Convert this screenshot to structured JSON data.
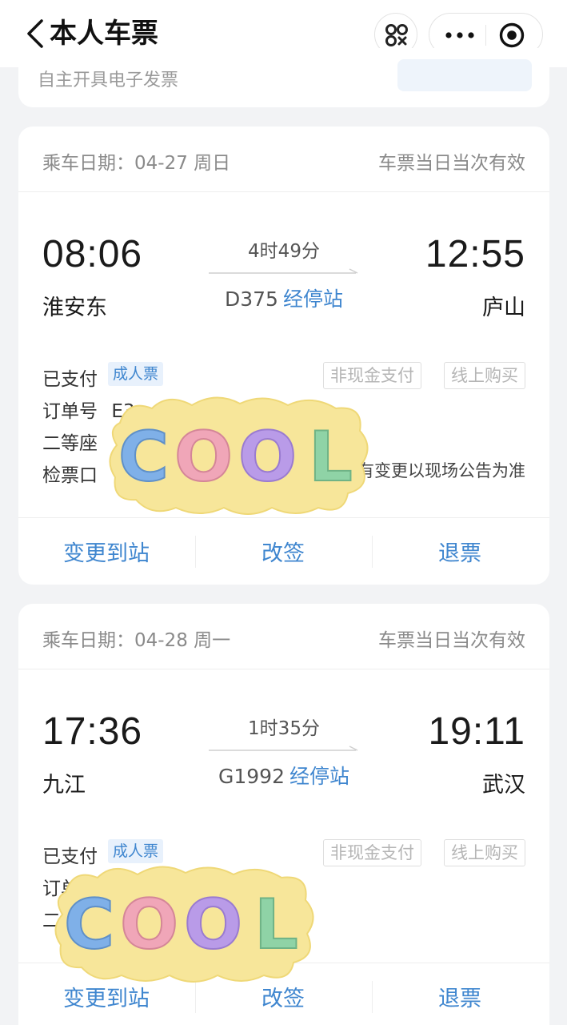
{
  "header": {
    "back_icon": "chevron-left-icon",
    "title": "本人车票",
    "scan_icon": "scan-icon",
    "more_icon": "more-dots-icon",
    "close_icon": "target-circle-icon"
  },
  "top_card": {
    "text": "自主开具电子发票"
  },
  "tickets": [
    {
      "date": "乘车日期：04-27 周日",
      "validity": "车票当日当次有效",
      "dep_time": "08:06",
      "dep_station": "淮安东",
      "duration": "4时49分",
      "train_no": "D375",
      "stops_link": "经停站",
      "arr_time": "12:55",
      "arr_station": "庐山",
      "paid": "已支付",
      "ticket_type": "成人票",
      "tag_cash": "非现金支付",
      "tag_online": "线上购买",
      "order_label": "订单号",
      "order_value": "E3",
      "seat_label": "二等座",
      "gate_label": "检票口",
      "gate_note": "有变更以现场公告为准",
      "actions": {
        "change_station": "变更到站",
        "reschedule": "改签",
        "refund": "退票"
      }
    },
    {
      "date": "乘车日期：04-28 周一",
      "validity": "车票当日当次有效",
      "dep_time": "17:36",
      "dep_station": "九江",
      "duration": "1时35分",
      "train_no": "G1992",
      "stops_link": "经停站",
      "arr_time": "19:11",
      "arr_station": "武汉",
      "paid": "已支付",
      "ticket_type": "成人票",
      "tag_cash": "非现金支付",
      "tag_online": "线上购买",
      "order_label": "订单",
      "seat_label": "二",
      "actions": {
        "change_station": "变更到站",
        "reschedule": "改签",
        "refund": "退票"
      }
    }
  ],
  "stickers": [
    {
      "text": "COOL",
      "letter_colors": [
        "#7fb0e8",
        "#f0a6b8",
        "#b99be8",
        "#8fd3a6"
      ],
      "bg_color": "#f7e69a"
    },
    {
      "text": "COOL",
      "letter_colors": [
        "#7fb0e8",
        "#f0a6b8",
        "#b99be8",
        "#8fd3a6"
      ],
      "bg_color": "#f7e69a"
    }
  ],
  "colors": {
    "accent": "#3f86cf",
    "badge_bg": "#e8f1fc"
  }
}
